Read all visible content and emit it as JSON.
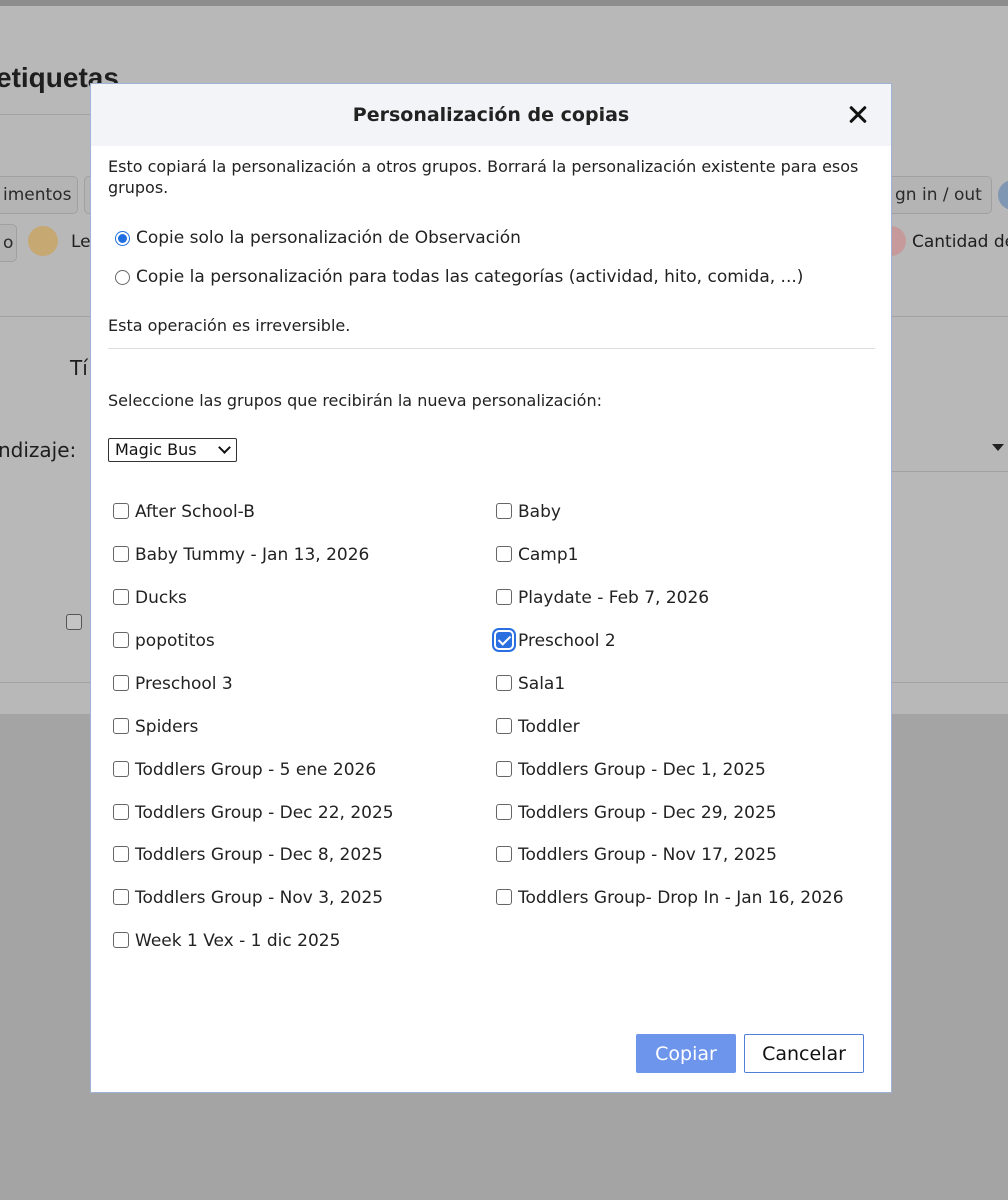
{
  "background": {
    "page_title": "etiquetas",
    "tab_left_1": "imentos",
    "tab_right_1": "gn in / out",
    "tab_left_2": "o",
    "tab_left_2b": "Le",
    "tab_right_2": "Cantidad de",
    "field_label": "Tí",
    "field_label_2": "ndizaje:"
  },
  "modal": {
    "title": "Personalización de copias",
    "description": "Esto copiará la personalización a otros grupos. Borrará la personalización existente para esos grupos.",
    "options": [
      {
        "label": "Copie solo la personalización de Observación",
        "checked": true
      },
      {
        "label": "Copie la personalización para todas las categorías (actividad, hito, comida, ...)",
        "checked": false
      }
    ],
    "irreversible_note": "Esta operación es irreversible.",
    "select_prompt": "Seleccione las grupos que recibirán la nueva personalización:",
    "center_select": {
      "value": "Magic Bus"
    },
    "groups": [
      {
        "label": "After School-B",
        "checked": false
      },
      {
        "label": "Baby",
        "checked": false
      },
      {
        "label": "Baby Tummy - Jan 13, 2026",
        "checked": false
      },
      {
        "label": "Camp1",
        "checked": false
      },
      {
        "label": "Ducks",
        "checked": false
      },
      {
        "label": "Playdate - Feb 7, 2026",
        "checked": false
      },
      {
        "label": "popotitos",
        "checked": false
      },
      {
        "label": "Preschool 2",
        "checked": true
      },
      {
        "label": "Preschool 3",
        "checked": false
      },
      {
        "label": "Sala1",
        "checked": false
      },
      {
        "label": "Spiders",
        "checked": false
      },
      {
        "label": "Toddler",
        "checked": false
      },
      {
        "label": "Toddlers Group - 5 ene 2026",
        "checked": false
      },
      {
        "label": "Toddlers Group - Dec 1, 2025",
        "checked": false
      },
      {
        "label": "Toddlers Group - Dec 22, 2025",
        "checked": false
      },
      {
        "label": "Toddlers Group - Dec 29, 2025",
        "checked": false
      },
      {
        "label": "Toddlers Group - Dec 8, 2025",
        "checked": false
      },
      {
        "label": "Toddlers Group - Nov 17, 2025",
        "checked": false
      },
      {
        "label": "Toddlers Group - Nov 3, 2025",
        "checked": false
      },
      {
        "label": "Toddlers Group- Drop In - Jan 16, 2026",
        "checked": false
      },
      {
        "label": "Week 1 Vex - 1 dic 2025",
        "checked": false
      }
    ],
    "copy_button": "Copiar",
    "cancel_button": "Cancelar"
  },
  "colors": {
    "accent": "#2a6fe0",
    "copy_button_bg": "#6d95ec",
    "overlay": "#a4a4a4"
  }
}
